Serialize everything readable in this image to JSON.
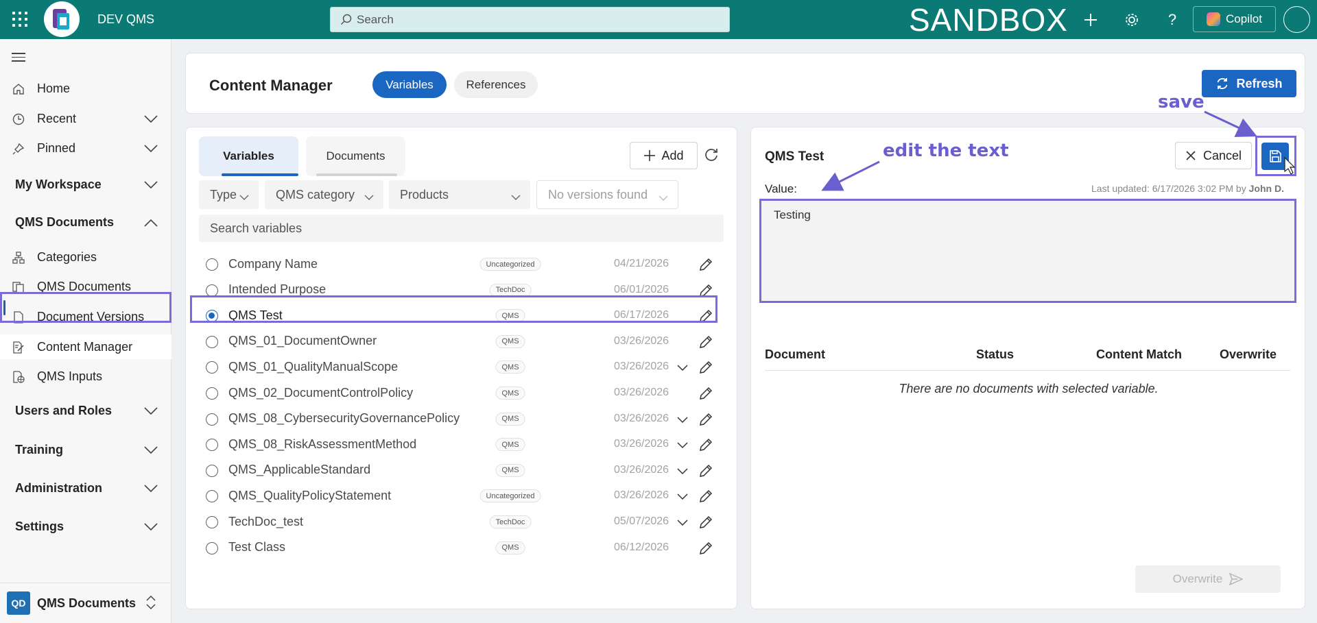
{
  "topbar": {
    "app_name": "DEV QMS",
    "search_placeholder": "Search",
    "environment": "SANDBOX",
    "copilot_label": "Copilot"
  },
  "sidebar": {
    "items": [
      {
        "label": "Home"
      },
      {
        "label": "Recent"
      },
      {
        "label": "Pinned"
      }
    ],
    "groups": [
      {
        "label": "My Workspace"
      },
      {
        "label": "QMS Documents"
      }
    ],
    "sub_items": [
      {
        "label": "Categories"
      },
      {
        "label": "QMS Documents"
      },
      {
        "label": "Document Versions"
      },
      {
        "label": "Content Manager"
      },
      {
        "label": "QMS Inputs"
      }
    ],
    "groups_bottom": [
      {
        "label": "Users and Roles"
      },
      {
        "label": "Training"
      },
      {
        "label": "Administration"
      },
      {
        "label": "Settings"
      }
    ],
    "switcher": {
      "badge": "QD",
      "label": "QMS Documents"
    }
  },
  "header": {
    "title": "Content Manager",
    "pills": [
      {
        "label": "Variables"
      },
      {
        "label": "References"
      }
    ],
    "refresh_label": "Refresh"
  },
  "left_panel": {
    "tabs": [
      {
        "label": "Variables"
      },
      {
        "label": "Documents"
      }
    ],
    "add_label": "Add",
    "filters": {
      "type": "Type",
      "category": "QMS category",
      "products": "Products",
      "versions": "No versions found"
    },
    "search_placeholder": "Search variables",
    "rows": [
      {
        "name": "Company Name",
        "badge": "Uncategorized",
        "date": "04/21/2026",
        "selected": false,
        "expandable": false
      },
      {
        "name": "Intended Purpose",
        "badge": "TechDoc",
        "date": "06/01/2026",
        "selected": false,
        "expandable": false
      },
      {
        "name": "QMS Test",
        "badge": "QMS",
        "date": "06/17/2026",
        "selected": true,
        "expandable": false
      },
      {
        "name": "QMS_01_DocumentOwner",
        "badge": "QMS",
        "date": "03/26/2026",
        "selected": false,
        "expandable": false
      },
      {
        "name": "QMS_01_QualityManualScope",
        "badge": "QMS",
        "date": "03/26/2026",
        "selected": false,
        "expandable": true
      },
      {
        "name": "QMS_02_DocumentControlPolicy",
        "badge": "QMS",
        "date": "03/26/2026",
        "selected": false,
        "expandable": false
      },
      {
        "name": "QMS_08_CybersecurityGovernancePolicy",
        "badge": "QMS",
        "date": "03/26/2026",
        "selected": false,
        "expandable": true
      },
      {
        "name": "QMS_08_RiskAssessmentMethod",
        "badge": "QMS",
        "date": "03/26/2026",
        "selected": false,
        "expandable": true
      },
      {
        "name": "QMS_ApplicableStandard",
        "badge": "QMS",
        "date": "03/26/2026",
        "selected": false,
        "expandable": true
      },
      {
        "name": "QMS_QualityPolicyStatement",
        "badge": "Uncategorized",
        "date": "03/26/2026",
        "selected": false,
        "expandable": true
      },
      {
        "name": "TechDoc_test",
        "badge": "TechDoc",
        "date": "05/07/2026",
        "selected": false,
        "expandable": true
      },
      {
        "name": "Test Class",
        "badge": "QMS",
        "date": "06/12/2026",
        "selected": false,
        "expandable": false
      }
    ]
  },
  "right_panel": {
    "title": "QMS Test",
    "cancel_label": "Cancel",
    "value_label": "Value:",
    "last_updated_prefix": "Last updated: 6/17/2026 3:02 PM by",
    "last_updated_user": "John D.",
    "value_text": "Testing",
    "columns": [
      "Document",
      "Status",
      "Content Match",
      "Overwrite"
    ],
    "empty_message": "There are no documents with selected variable.",
    "overwrite_label": "Overwrite"
  },
  "annotations": {
    "save": "save",
    "edit": "edit the text"
  },
  "colors": {
    "topbar": "#0b7a75",
    "primary": "#1a66c0",
    "annotation": "#7a6bd8"
  }
}
